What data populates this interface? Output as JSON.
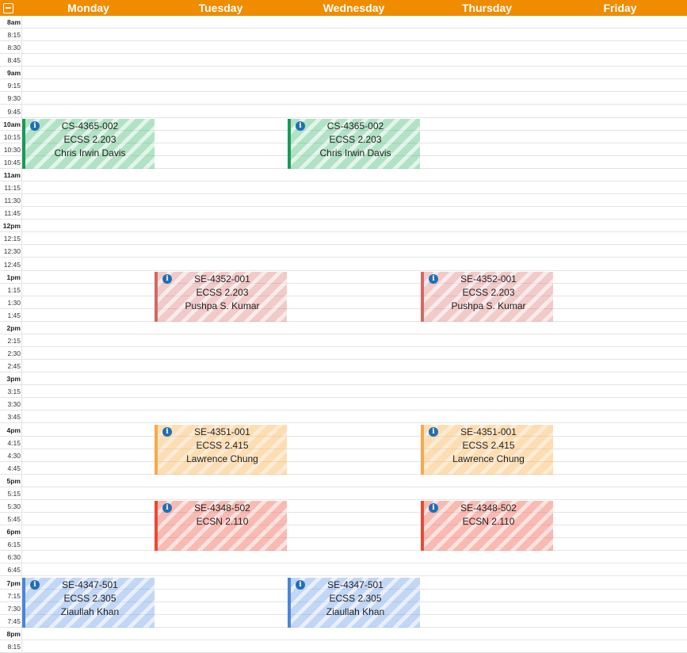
{
  "header": {
    "collapse_icon": "minus-square-icon",
    "days": [
      "Monday",
      "Tuesday",
      "Wednesday",
      "Thursday",
      "Friday"
    ]
  },
  "time_labels": [
    "8am",
    "8:15",
    "8:30",
    "8:45",
    "9am",
    "9:15",
    "9:30",
    "9:45",
    "10am",
    "10:15",
    "10:30",
    "10:45",
    "11am",
    "11:15",
    "11:30",
    "11:45",
    "12pm",
    "12:15",
    "12:30",
    "12:45",
    "1pm",
    "1:15",
    "1:30",
    "1:45",
    "2pm",
    "2:15",
    "2:30",
    "2:45",
    "3pm",
    "3:15",
    "3:30",
    "3:45",
    "4pm",
    "4:15",
    "4:30",
    "4:45",
    "5pm",
    "5:15",
    "5:30",
    "5:45",
    "6pm",
    "6:15",
    "6:30",
    "6:45",
    "7pm",
    "7:15",
    "7:30",
    "7:45",
    "8pm",
    "8:15"
  ],
  "colors": {
    "header": "#ef8c00",
    "green": "#1a9a5a",
    "red": "#d06a64",
    "orange": "#f6a94c",
    "coral": "#e84a35",
    "blue": "#4a86d8"
  },
  "events": [
    {
      "day": 0,
      "start": "10am",
      "end": "11am",
      "course": "CS-4365-002",
      "room": "ECSS 2.203",
      "instructor": "Chris Irwin Davis",
      "color": "green"
    },
    {
      "day": 2,
      "start": "10am",
      "end": "11am",
      "course": "CS-4365-002",
      "room": "ECSS 2.203",
      "instructor": "Chris Irwin Davis",
      "color": "green"
    },
    {
      "day": 1,
      "start": "1pm",
      "end": "2pm",
      "course": "SE-4352-001",
      "room": "ECSS 2.203",
      "instructor": "Pushpa S. Kumar",
      "color": "red"
    },
    {
      "day": 3,
      "start": "1pm",
      "end": "2pm",
      "course": "SE-4352-001",
      "room": "ECSS 2.203",
      "instructor": "Pushpa S. Kumar",
      "color": "red"
    },
    {
      "day": 1,
      "start": "4pm",
      "end": "5pm",
      "course": "SE-4351-001",
      "room": "ECSS 2.415",
      "instructor": "Lawrence Chung",
      "color": "orange"
    },
    {
      "day": 3,
      "start": "4pm",
      "end": "5pm",
      "course": "SE-4351-001",
      "room": "ECSS 2.415",
      "instructor": "Lawrence Chung",
      "color": "orange"
    },
    {
      "day": 1,
      "start": "5:30",
      "end": "6:30",
      "course": "SE-4348-502",
      "room": "ECSN 2.110",
      "instructor": "",
      "color": "coral"
    },
    {
      "day": 3,
      "start": "5:30",
      "end": "6:30",
      "course": "SE-4348-502",
      "room": "ECSN 2.110",
      "instructor": "",
      "color": "coral"
    },
    {
      "day": 0,
      "start": "7pm",
      "end": "8pm",
      "course": "SE-4347-501",
      "room": "ECSS 2.305",
      "instructor": "Ziaullah Khan",
      "color": "blue"
    },
    {
      "day": 2,
      "start": "7pm",
      "end": "8pm",
      "course": "SE-4347-501",
      "room": "ECSS 2.305",
      "instructor": "Ziaullah Khan",
      "color": "blue"
    }
  ]
}
